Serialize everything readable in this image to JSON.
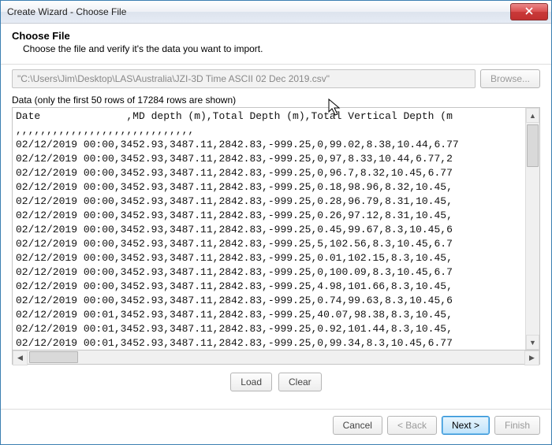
{
  "titlebar": {
    "title": "Create Wizard - Choose File"
  },
  "header": {
    "title": "Choose File",
    "subtitle": "Choose the file and verify it's the data you want to import."
  },
  "file": {
    "path": "\"C:\\Users\\Jim\\Desktop\\LAS\\Australia\\JZI-3D Time ASCII 02 Dec 2019.csv\"",
    "browse": "Browse..."
  },
  "data_label": "Data (only the first 50 rows of 17284 rows are shown)",
  "preview_lines": [
    "Date              ,MD depth (m),Total Depth (m),Total Vertical Depth (m",
    ",,,,,,,,,,,,,,,,,,,,,,,,,,,,,",
    "02/12/2019 00:00,3452.93,3487.11,2842.83,-999.25,0,99.02,8.38,10.44,6.77",
    "02/12/2019 00:00,3452.93,3487.11,2842.83,-999.25,0,97,8.33,10.44,6.77,2",
    "02/12/2019 00:00,3452.93,3487.11,2842.83,-999.25,0,96.7,8.32,10.45,6.77",
    "02/12/2019 00:00,3452.93,3487.11,2842.83,-999.25,0.18,98.96,8.32,10.45,",
    "02/12/2019 00:00,3452.93,3487.11,2842.83,-999.25,0.28,96.79,8.31,10.45,",
    "02/12/2019 00:00,3452.93,3487.11,2842.83,-999.25,0.26,97.12,8.31,10.45,",
    "02/12/2019 00:00,3452.93,3487.11,2842.83,-999.25,0.45,99.67,8.3,10.45,6",
    "02/12/2019 00:00,3452.93,3487.11,2842.83,-999.25,5,102.56,8.3,10.45,6.7",
    "02/12/2019 00:00,3452.93,3487.11,2842.83,-999.25,0.01,102.15,8.3,10.45,",
    "02/12/2019 00:00,3452.93,3487.11,2842.83,-999.25,0,100.09,8.3,10.45,6.7",
    "02/12/2019 00:00,3452.93,3487.11,2842.83,-999.25,4.98,101.66,8.3,10.45,",
    "02/12/2019 00:00,3452.93,3487.11,2842.83,-999.25,0.74,99.63,8.3,10.45,6",
    "02/12/2019 00:01,3452.93,3487.11,2842.83,-999.25,40.07,98.38,8.3,10.45,",
    "02/12/2019 00:01,3452.93,3487.11,2842.83,-999.25,0.92,101.44,8.3,10.45,",
    "02/12/2019 00:01,3452.93,3487.11,2842.83,-999.25,0,99.34,8.3,10.45,6.77"
  ],
  "buttons": {
    "load": "Load",
    "clear": "Clear",
    "cancel": "Cancel",
    "back": "< Back",
    "next": "Next >",
    "finish": "Finish"
  }
}
